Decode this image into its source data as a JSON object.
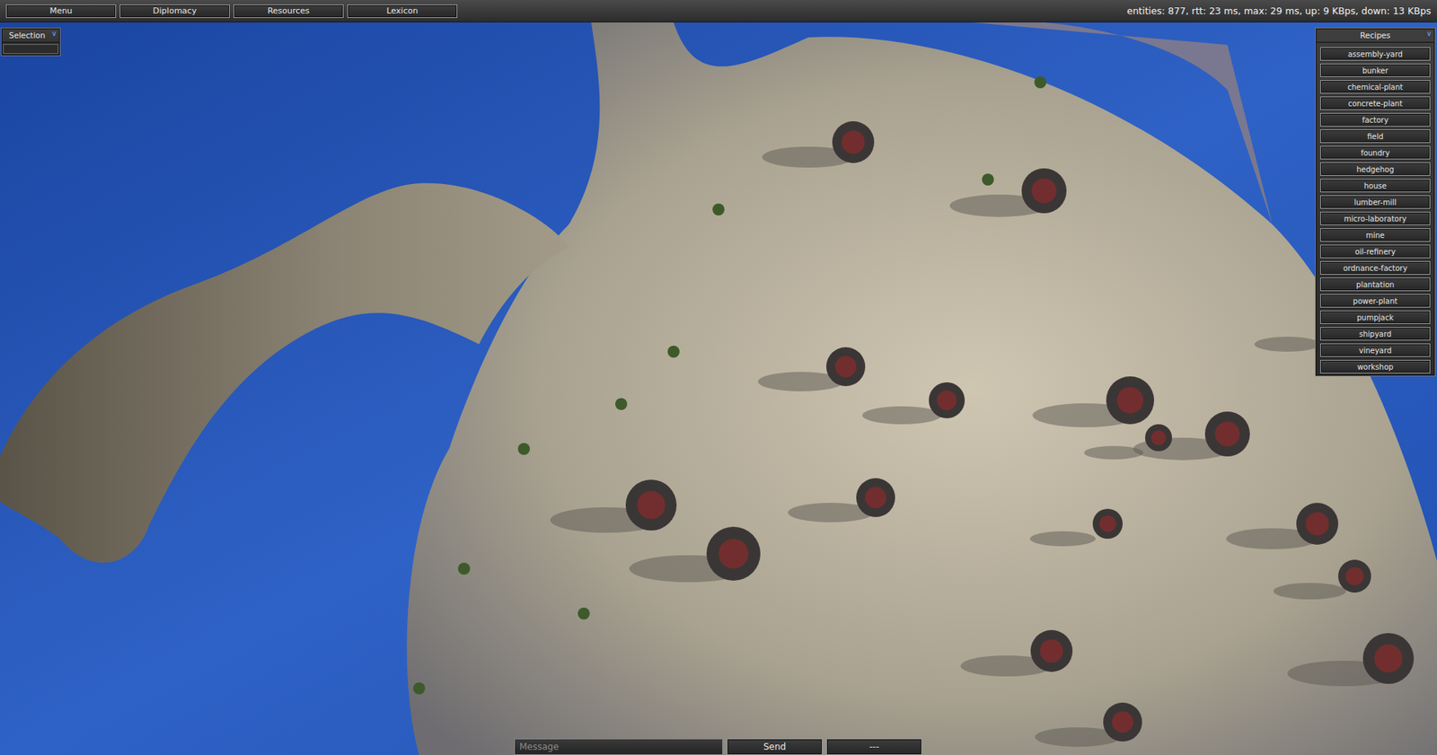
{
  "menu_bar": {
    "buttons": [
      "Menu",
      "Diplomacy",
      "Resources",
      "Lexicon"
    ],
    "stats": "entities: 877, rtt: 23 ms, max: 29 ms, up: 9 KBps, down: 13 KBps"
  },
  "selection_panel": {
    "title": "Selection",
    "toggle": "∨"
  },
  "recipes_panel": {
    "title": "Recipes",
    "toggle": "∨",
    "items": [
      "assembly-yard",
      "bunker",
      "chemical-plant",
      "concrete-plant",
      "factory",
      "field",
      "foundry",
      "hedgehog",
      "house",
      "lumber-mill",
      "micro-laboratory",
      "mine",
      "oil-refinery",
      "ordnance-factory",
      "plantation",
      "power-plant",
      "pumpjack",
      "shipyard",
      "vineyard",
      "workshop"
    ]
  },
  "chat": {
    "placeholder": "Message",
    "send": "Send",
    "extra": "---"
  }
}
